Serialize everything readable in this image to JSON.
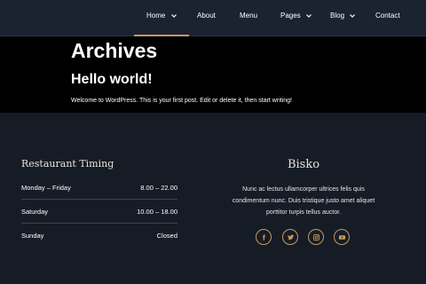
{
  "nav": {
    "home": "Home",
    "about": "About",
    "menu": "Menu",
    "pages": "Pages",
    "blog": "Blog",
    "contact": "Contact"
  },
  "hero": {
    "title": "Archives",
    "post_title": "Hello world!",
    "excerpt": "Welcome to WordPress. This is your first post. Edit or delete it, then start writing!"
  },
  "footer": {
    "timing_title": "Restaurant Timing",
    "timing": [
      {
        "day": "Monday – Friday",
        "hours": "8.00 – 22.00"
      },
      {
        "day": "Saturday",
        "hours": "10.00 – 18.00"
      },
      {
        "day": "Sunday",
        "hours": "Closed"
      }
    ],
    "brand": "Bisko",
    "brand_text": "Nunc ac lectus ullamcorper ultrices felis quis condimentum nunc. Duis tristique justo amet aliquet porttitor turpis tellus auctor.",
    "social": [
      "facebook-icon",
      "twitter-icon",
      "instagram-icon",
      "youtube-icon"
    ]
  },
  "colors": {
    "accent": "#c79a5e",
    "header_bg": "#1b2230",
    "hero_bg": "#000000",
    "footer_bg": "#161c26"
  }
}
